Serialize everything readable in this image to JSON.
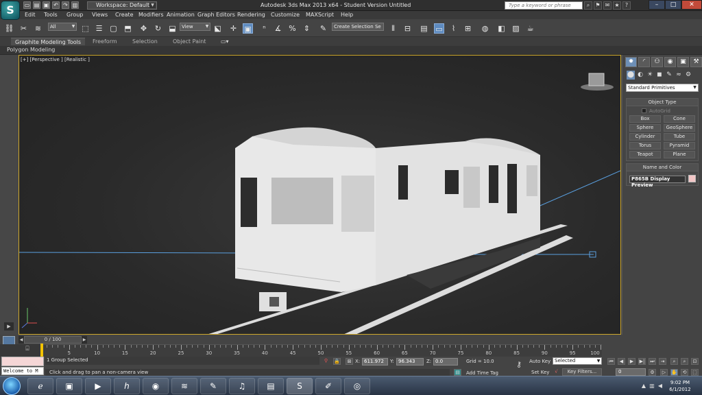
{
  "titlebar": {
    "logo": "S",
    "quick_access_icons": [
      "new-file-icon",
      "open-icon",
      "save-icon",
      "undo-icon",
      "redo-icon",
      "project-icon"
    ],
    "workspace_label": "Workspace: Default",
    "title": "Autodesk 3ds Max  2013 x64   - Student Version   Untitled",
    "search_placeholder": "Type a keyword or phrase",
    "window_controls": {
      "minimize": "–",
      "maximize": "□",
      "close": "✕"
    }
  },
  "menu": [
    "Edit",
    "Tools",
    "Group",
    "Views",
    "Create",
    "Modifiers",
    "Animation",
    "Graph Editors",
    "Rendering",
    "Customize",
    "MAXScript",
    "Help"
  ],
  "toolbar": {
    "selection_filter": "All",
    "reference_coord": "View",
    "named_selection": "Create Selection Se"
  },
  "ribbon": {
    "tabs": [
      "Graphite Modeling Tools",
      "Freeform",
      "Selection",
      "Object Paint"
    ],
    "active_tab": "Graphite Modeling Tools",
    "sub_panel": "Polygon Modeling"
  },
  "viewport": {
    "label": "[+] [Perspective ] [Realistic ]",
    "colors": {
      "border": "#cfa92c",
      "model": "#e6e6e6",
      "guide": "#5aa0e0"
    }
  },
  "command_panel": {
    "category_dropdown": "Standard Primitives",
    "object_type_title": "Object Type",
    "autogrid_label": "AutoGrid",
    "primitives": [
      "Box",
      "Cone",
      "Sphere",
      "GeoSphere",
      "Cylinder",
      "Tube",
      "Torus",
      "Pyramid",
      "Teapot",
      "Plane"
    ],
    "name_color_title": "Name and Color",
    "object_name": "P865B Display Preview",
    "object_color": "#f2c6c6"
  },
  "timeline": {
    "frame_counter": "0 / 100",
    "ticks": [
      "5",
      "10",
      "15",
      "20",
      "25",
      "30",
      "35",
      "40",
      "45",
      "50",
      "55",
      "60",
      "65",
      "70",
      "75",
      "80",
      "85",
      "90",
      "95",
      "100"
    ]
  },
  "status": {
    "selection_info": "1 Group Selected",
    "prompt": "Click and drag to pan a non-camera view",
    "maxscript_listener": "Welcome to M",
    "x_label": "X:",
    "x_value": "611.972",
    "y_label": "Y:",
    "y_value": "96.343",
    "z_label": "Z:",
    "z_value": "0.0",
    "grid": "Grid = 10.0",
    "add_time_tag": "Add Time Tag",
    "auto_key": "Auto Key",
    "set_key": "Set Key",
    "key_mode_selected": "Selected",
    "key_filters": "Key Filters...",
    "current_frame": "0"
  },
  "taskbar": {
    "apps": [
      "ie-icon",
      "explorer-icon",
      "media-player-icon",
      "hp-icon",
      "firefox-icon",
      "spotify-icon",
      "paint-icon",
      "itunes-icon",
      "notes-icon",
      "3dsmax-icon",
      "gimp-icon",
      "chrome-icon"
    ],
    "time": "9:02 PM",
    "date": "6/1/2012"
  }
}
